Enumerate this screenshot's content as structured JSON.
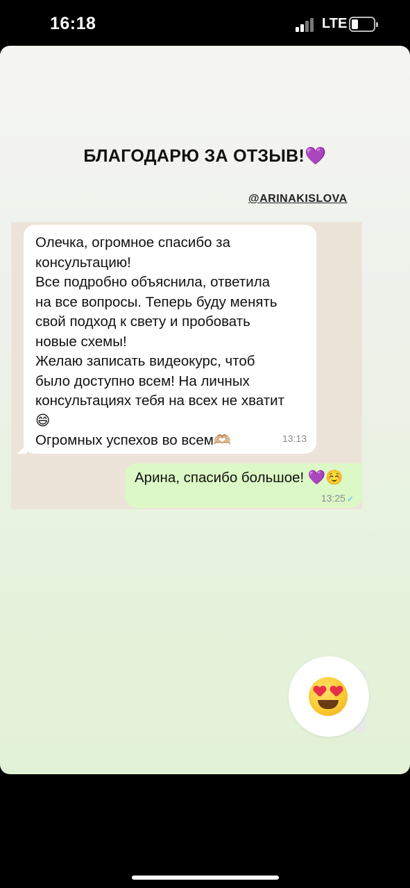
{
  "status_bar": {
    "time": "16:18",
    "network": "LTE"
  },
  "story": {
    "title": "БЛАГОДАРЮ ЗА ОТЗЫВ!💜",
    "handle": "@ARINAKISLOVA"
  },
  "chat": {
    "incoming": {
      "lines": [
        "Олечка, огромное спасибо за",
        "консультацию!",
        "Все подробно объяснила, ответила",
        "на все вопросы. Теперь буду менять",
        "свой подход к свету и пробовать",
        "новые схемы!",
        "Желаю записать видеокурс, чтоб",
        "было доступно всем! На личных",
        "консультациях тебя на всех не хватит",
        "😄",
        "Огромных успехов во всем🫶🏼"
      ],
      "time": "13:13"
    },
    "outgoing": {
      "text": "Арина, спасибо большое! 💜☺️",
      "time": "13:25"
    }
  },
  "reaction": {
    "icon": "heart-eyes-emoji-icon"
  }
}
